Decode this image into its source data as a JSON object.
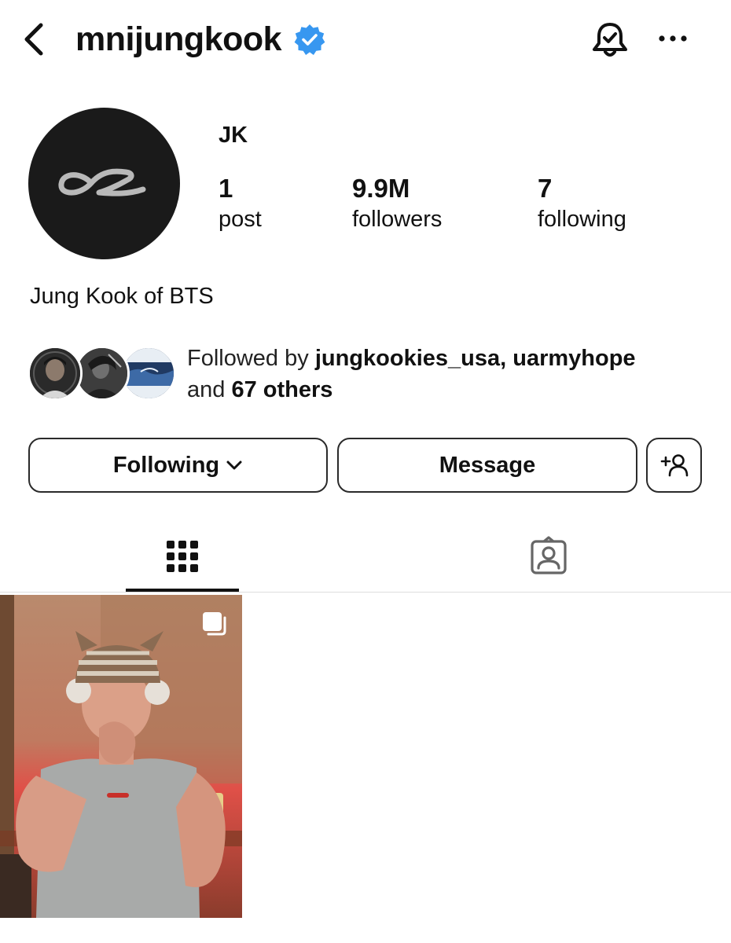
{
  "header": {
    "username": "mnijungkook"
  },
  "profile": {
    "display_name": "JK",
    "bio": "Jung Kook of BTS"
  },
  "stats": {
    "posts_count": "1",
    "posts_label": "post",
    "followers_count": "9.9M",
    "followers_label": "followers",
    "following_count": "7",
    "following_label": "following"
  },
  "followed_by": {
    "prefix": "Followed by ",
    "names": "jungkookies_usa, uarmyhope",
    "conjunction": "and ",
    "others": "67 others"
  },
  "actions": {
    "following_label": "Following",
    "message_label": "Message"
  },
  "icons": {
    "back": "chevron-left-icon",
    "verified": "verified-badge-icon",
    "notifications": "bell-check-icon",
    "more": "more-horizontal-icon",
    "add_user": "add-user-icon",
    "grid": "grid-icon",
    "tagged": "tagged-person-icon",
    "multi_post": "carousel-icon"
  },
  "colors": {
    "verified_blue": "#3797f0",
    "text": "#111111",
    "border": "#2a2a2a",
    "avatar_bg": "#1a1a1a"
  }
}
